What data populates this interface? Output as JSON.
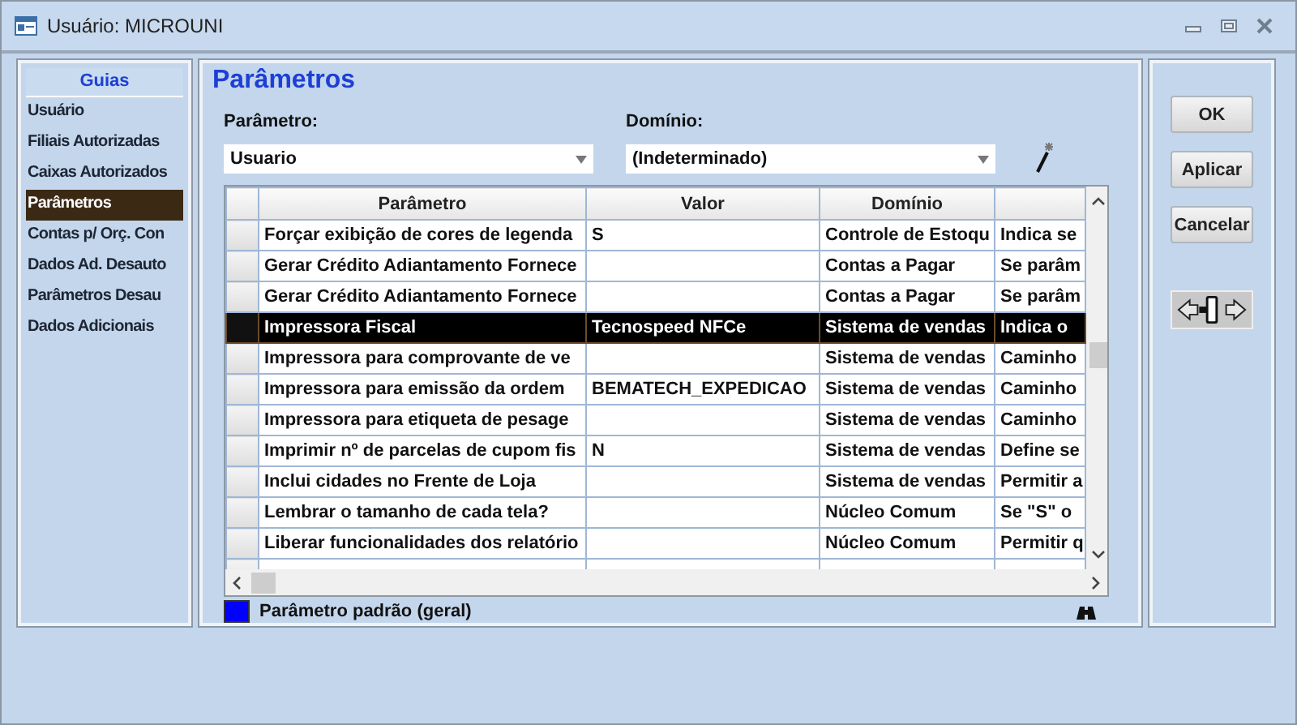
{
  "window": {
    "title": "Usuário: MICROUNI"
  },
  "sidebar": {
    "heading": "Guias",
    "items": [
      {
        "label": "Usuário",
        "selected": false
      },
      {
        "label": "Filiais Autorizadas",
        "selected": false
      },
      {
        "label": "Caixas Autorizados",
        "selected": false
      },
      {
        "label": "Parâmetros",
        "selected": true
      },
      {
        "label": "Contas p/ Orç. Con",
        "selected": false
      },
      {
        "label": "Dados Ad. Desauto",
        "selected": false
      },
      {
        "label": "Parâmetros Desau",
        "selected": false
      },
      {
        "label": "Dados Adicionais",
        "selected": false
      }
    ]
  },
  "panel": {
    "title": "Parâmetros",
    "fields": [
      {
        "label": "Parâmetro:",
        "value": "Usuario"
      },
      {
        "label": "Domínio:",
        "value": "(Indeterminado)"
      }
    ]
  },
  "table": {
    "columns": [
      "Parâmetro",
      "Valor",
      "Domínio"
    ],
    "rows": [
      {
        "cells": [
          "Forçar exibição de cores de legenda",
          "S",
          "Controle de Estoqu",
          "Indica se"
        ],
        "selected": false
      },
      {
        "cells": [
          "Gerar Crédito Adiantamento Fornece",
          "",
          "Contas a Pagar",
          "Se parâm"
        ],
        "selected": false
      },
      {
        "cells": [
          "Gerar Crédito Adiantamento Fornece",
          "",
          "Contas a Pagar",
          "Se parâm"
        ],
        "selected": false
      },
      {
        "cells": [
          "Impressora Fiscal",
          "Tecnospeed NFCe",
          "Sistema de vendas",
          "Indica o"
        ],
        "selected": true
      },
      {
        "cells": [
          "Impressora para comprovante de ve",
          "",
          "Sistema de vendas",
          "Caminho"
        ],
        "selected": false
      },
      {
        "cells": [
          "Impressora para emissão da ordem",
          "BEMATECH_EXPEDICAO",
          "Sistema de vendas",
          "Caminho"
        ],
        "selected": false
      },
      {
        "cells": [
          "Impressora para etiqueta de pesage",
          "",
          "Sistema de vendas",
          "Caminho"
        ],
        "selected": false
      },
      {
        "cells": [
          "Imprimir nº de parcelas de cupom fis",
          "N",
          "Sistema de vendas",
          "Define se"
        ],
        "selected": false
      },
      {
        "cells": [
          "Inclui cidades no Frente de Loja",
          "",
          "Sistema de vendas",
          "Permitir a"
        ],
        "selected": false
      },
      {
        "cells": [
          "Lembrar o tamanho de cada tela?",
          "",
          "Núcleo Comum",
          "Se \"S\" o"
        ],
        "selected": false
      },
      {
        "cells": [
          "Liberar funcionalidades dos relatório",
          "",
          "Núcleo Comum",
          "Permitir q"
        ],
        "selected": false
      }
    ]
  },
  "legend": {
    "label": "Parâmetro padrão (geral)",
    "color": "#0000ff"
  },
  "buttons": [
    "OK",
    "Aplicar",
    "Cancelar"
  ]
}
